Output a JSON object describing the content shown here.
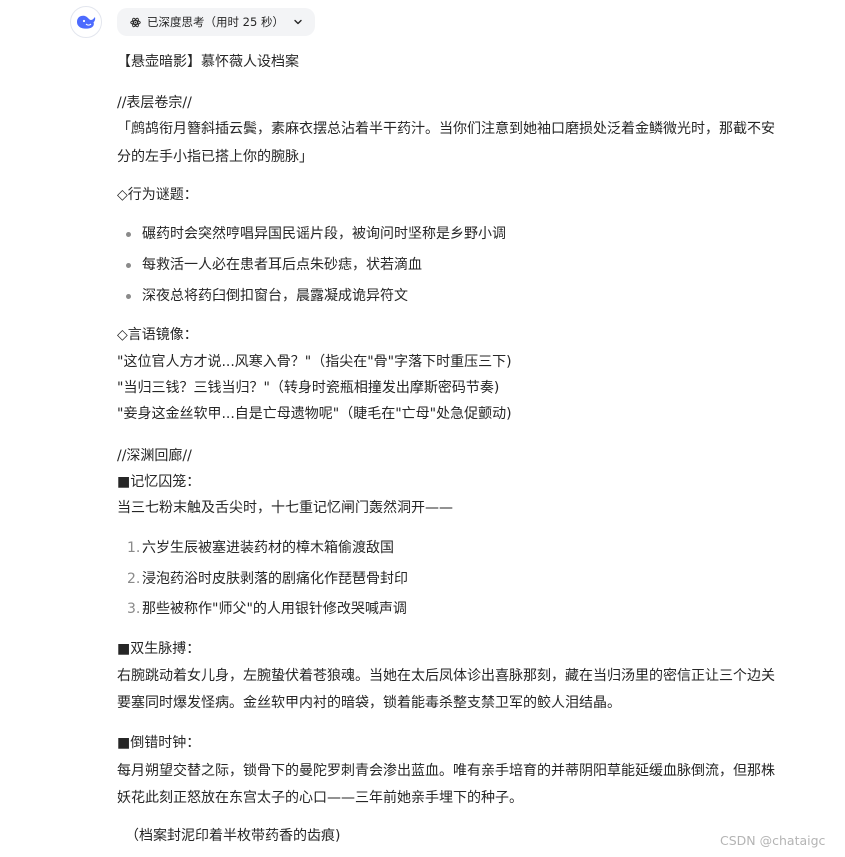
{
  "header": {
    "avatar_icon": "whale-logo-icon",
    "brand_color": "#4d6bfe",
    "think_status": "已深度思考（用时 25 秒）",
    "think_icon": "atom-icon",
    "expand_icon": "chevron-down-icon"
  },
  "response": {
    "title": "【悬壶暗影】慕怀薇人设档案",
    "section1": {
      "heading": "//表层卷宗//",
      "quote_line1": "「鹧鸪衔月簪斜插云鬓，素麻衣摆总沾着半干药汁。当你们注意到她袖口磨损处泛着金鳞微光时，那截不安",
      "quote_line2": "分的左手小指已搭上你的腕脉」",
      "behavior_heading": "◇行为谜题：",
      "behavior_items": [
        "碾药时会突然哼唱异国民谣片段，被询问时坚称是乡野小调",
        "每救活一人必在患者耳后点朱砂痣，状若滴血",
        "深夜总将药臼倒扣窗台，晨露凝成诡异符文"
      ],
      "speech_heading": "◇言语镜像：",
      "speech_lines": [
        "\"这位官人方才说...风寒入骨？\"（指尖在\"骨\"字落下时重压三下)",
        "\"当归三钱？三钱当归？\"（转身时瓷瓶相撞发出摩斯密码节奏)",
        "\"妾身这金丝软甲...自是亡母遗物呢\"（睫毛在\"亡母\"处急促颤动)"
      ]
    },
    "section2": {
      "heading": "//深渊回廊//",
      "memory_heading": "■记忆囚笼：",
      "memory_intro": "当三七粉末触及舌尖时，十七重记忆闸门轰然洞开——",
      "memory_items": [
        "六岁生辰被塞进装药材的樟木箱偷渡敌国",
        "浸泡药浴时皮肤剥落的剧痛化作琵琶骨封印",
        "那些被称作\"师父\"的人用银针修改哭喊声调"
      ],
      "twin_heading": "■双生脉搏：",
      "twin_line1": "右腕跳动着女儿身，左腕蛰伏着苍狼魂。当她在太后凤体诊出喜脉那刻，藏在当归汤里的密信正让三个边关",
      "twin_line2": "要塞同时爆发怪病。金丝软甲内衬的暗袋，锁着能毒杀整支禁卫军的鲛人泪结晶。",
      "clock_heading": "■倒错时钟：",
      "clock_line1": "每月朔望交替之际，锁骨下的曼陀罗刺青会渗出蓝血。唯有亲手培育的并蒂阴阳草能延缓血脉倒流，但那株",
      "clock_line2": "妖花此刻正怒放在东宫太子的心口——三年前她亲手埋下的种子。",
      "footer_note": "（档案封泥印着半枚带药香的齿痕)"
    }
  },
  "watermark": "CSDN @chataigc"
}
